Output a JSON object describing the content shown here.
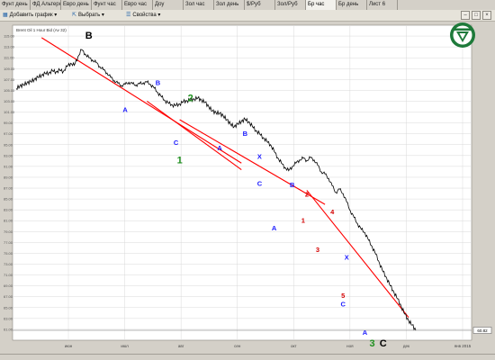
{
  "tabs": [
    {
      "label": "Фунт день",
      "active": false
    },
    {
      "label": "ФД Альтернатива",
      "active": false
    },
    {
      "label": "Евро день",
      "active": false
    },
    {
      "label": "Фунт час",
      "active": false
    },
    {
      "label": "Евро час",
      "active": false
    },
    {
      "label": "Доу",
      "active": false
    },
    {
      "label": "Зол час",
      "active": false
    },
    {
      "label": "Зол день",
      "active": false
    },
    {
      "label": "$/Руб",
      "active": false
    },
    {
      "label": "Зол/Руб",
      "active": false
    },
    {
      "label": "Бр час",
      "active": true
    },
    {
      "label": "Бр день",
      "active": false
    },
    {
      "label": "Лист 6",
      "active": false
    }
  ],
  "toolbar": {
    "add_chart": "Добавить график",
    "select": "Выбрать",
    "properties": "Свойства"
  },
  "window_controls": [
    "–",
    "□",
    "×"
  ],
  "chart_data": {
    "type": "line",
    "title": "Brent Oil 1 Hour Bid (Av 32)",
    "x_tick_labels": [
      "июн",
      "июл",
      "авг",
      "сен",
      "окт",
      "ноя",
      "дек",
      "янв 2015"
    ],
    "y_tick_labels": [
      "115.00",
      "113.00",
      "111.00",
      "109.00",
      "107.00",
      "105.00",
      "103.00",
      "101.00",
      "99.00",
      "97.00",
      "95.00",
      "93.00",
      "91.00",
      "89.00",
      "87.00",
      "85.00",
      "83.00",
      "81.00",
      "79.00",
      "77.00",
      "75.00",
      "73.00",
      "71.00",
      "69.00",
      "67.00",
      "65.00",
      "63.00",
      "61.00"
    ],
    "ylim": [
      59,
      117
    ],
    "grid": true,
    "last_price": "60.82",
    "series_color": "#000000",
    "trendline_color": "#ff0000",
    "price": [
      [
        0,
        105.3
      ],
      [
        2,
        105.8
      ],
      [
        4,
        106.0
      ],
      [
        6,
        106.4
      ],
      [
        8,
        106.6
      ],
      [
        10,
        107.0
      ],
      [
        12,
        107.4
      ],
      [
        14,
        107.8
      ],
      [
        16,
        108.1
      ],
      [
        18,
        108.2
      ],
      [
        20,
        108.6
      ],
      [
        22,
        108.4
      ],
      [
        24,
        108.7
      ],
      [
        26,
        108.5
      ],
      [
        28,
        109.4
      ],
      [
        30,
        110.0
      ],
      [
        32,
        109.6
      ],
      [
        34,
        111.2
      ],
      [
        36,
        112.5
      ],
      [
        38,
        111.7
      ],
      [
        40,
        111.0
      ],
      [
        42,
        110.6
      ],
      [
        44,
        110.1
      ],
      [
        46,
        109.4
      ],
      [
        48,
        108.8
      ],
      [
        50,
        108.2
      ],
      [
        52,
        107.4
      ],
      [
        54,
        106.8
      ],
      [
        56,
        106.3
      ],
      [
        58,
        105.9
      ],
      [
        60,
        106.1
      ],
      [
        62,
        106.5
      ],
      [
        64,
        106.2
      ],
      [
        66,
        106.0
      ],
      [
        68,
        106.2
      ],
      [
        70,
        106.4
      ],
      [
        72,
        106.5
      ],
      [
        74,
        106.1
      ],
      [
        76,
        105.4
      ],
      [
        78,
        104.6
      ],
      [
        80,
        103.8
      ],
      [
        82,
        103.1
      ],
      [
        84,
        102.6
      ],
      [
        86,
        102.3
      ],
      [
        88,
        102.2
      ],
      [
        90,
        102.5
      ],
      [
        92,
        102.9
      ],
      [
        94,
        103.1
      ],
      [
        96,
        103.2
      ],
      [
        98,
        103.4
      ],
      [
        100,
        103.6
      ],
      [
        102,
        103.2
      ],
      [
        104,
        102.8
      ],
      [
        106,
        102.0
      ],
      [
        108,
        101.2
      ],
      [
        110,
        100.9
      ],
      [
        112,
        100.8
      ],
      [
        114,
        100.3
      ],
      [
        116,
        99.6
      ],
      [
        118,
        98.8
      ],
      [
        120,
        98.3
      ],
      [
        122,
        98.8
      ],
      [
        124,
        99.3
      ],
      [
        126,
        99.7
      ],
      [
        128,
        99.2
      ],
      [
        130,
        98.4
      ],
      [
        132,
        97.6
      ],
      [
        134,
        97.0
      ],
      [
        136,
        96.3
      ],
      [
        138,
        95.6
      ],
      [
        140,
        95.0
      ],
      [
        142,
        93.8
      ],
      [
        144,
        92.6
      ],
      [
        146,
        91.6
      ],
      [
        148,
        90.8
      ],
      [
        150,
        90.2
      ],
      [
        152,
        91.0
      ],
      [
        154,
        91.6
      ],
      [
        156,
        92.2
      ],
      [
        158,
        92.5
      ],
      [
        160,
        92.1
      ],
      [
        162,
        92.6
      ],
      [
        164,
        92.2
      ],
      [
        166,
        91.2
      ],
      [
        168,
        90.0
      ],
      [
        170,
        89.6
      ],
      [
        172,
        88.8
      ],
      [
        174,
        87.4
      ],
      [
        176,
        86.2
      ],
      [
        178,
        86.8
      ],
      [
        180,
        86.0
      ],
      [
        182,
        84.4
      ],
      [
        184,
        82.8
      ],
      [
        186,
        81.6
      ],
      [
        188,
        80.4
      ],
      [
        190,
        79.4
      ],
      [
        192,
        78.8
      ],
      [
        194,
        77.4
      ],
      [
        196,
        76.2
      ],
      [
        198,
        74.8
      ],
      [
        200,
        73.2
      ],
      [
        202,
        71.6
      ],
      [
        204,
        70.4
      ],
      [
        206,
        69.0
      ],
      [
        208,
        67.8
      ],
      [
        210,
        66.6
      ],
      [
        212,
        65.2
      ],
      [
        214,
        63.8
      ],
      [
        216,
        62.6
      ],
      [
        218,
        61.8
      ],
      [
        220,
        60.8
      ]
    ],
    "trendlines": [
      [
        [
          14,
          114.7
        ],
        [
          124,
          91.6
        ]
      ],
      [
        [
          72,
          103.0
        ],
        [
          124,
          90.4
        ]
      ],
      [
        [
          90,
          99.6
        ],
        [
          170,
          84.0
        ]
      ],
      [
        [
          160,
          86.6
        ],
        [
          216,
          63.2
        ]
      ]
    ],
    "wave_labels": [
      {
        "text": "B",
        "color": "#000000",
        "x": 40,
        "y": 114.5
      },
      {
        "text": "A",
        "color": "#1a1aff",
        "x": 60,
        "y": 101.0
      },
      {
        "text": "B",
        "color": "#1a1aff",
        "x": 78,
        "y": 106.0
      },
      {
        "text": "C",
        "color": "#1a1aff",
        "x": 88,
        "y": 95.0
      },
      {
        "text": "2",
        "color": "#1f8f1f",
        "x": 96,
        "y": 103.0
      },
      {
        "text": "1",
        "color": "#1f8f1f",
        "x": 90,
        "y": 91.6
      },
      {
        "text": "A",
        "color": "#1a1aff",
        "x": 112,
        "y": 94.0
      },
      {
        "text": "B",
        "color": "#1a1aff",
        "x": 126,
        "y": 96.6
      },
      {
        "text": "X",
        "color": "#1a1aff",
        "x": 134,
        "y": 92.4
      },
      {
        "text": "C",
        "color": "#1a1aff",
        "x": 134,
        "y": 87.4
      },
      {
        "text": "A",
        "color": "#1a1aff",
        "x": 142,
        "y": 79.2
      },
      {
        "text": "B",
        "color": "#1a1aff",
        "x": 152,
        "y": 87.2
      },
      {
        "text": "2",
        "color": "#d40000",
        "x": 160,
        "y": 85.4
      },
      {
        "text": "1",
        "color": "#d40000",
        "x": 158,
        "y": 80.6
      },
      {
        "text": "4",
        "color": "#d40000",
        "x": 174,
        "y": 82.2
      },
      {
        "text": "3",
        "color": "#d40000",
        "x": 166,
        "y": 75.2
      },
      {
        "text": "X",
        "color": "#1a1aff",
        "x": 182,
        "y": 73.8
      },
      {
        "text": "5",
        "color": "#d40000",
        "x": 180,
        "y": 66.8
      },
      {
        "text": "C",
        "color": "#1a1aff",
        "x": 180,
        "y": 65.2
      },
      {
        "text": "A",
        "color": "#1a1aff",
        "x": 192,
        "y": 60.0
      },
      {
        "text": "3",
        "color": "#1f8f1f",
        "x": 196,
        "y": 57.8
      },
      {
        "text": "C",
        "color": "#000000",
        "x": 202,
        "y": 57.8
      }
    ]
  }
}
